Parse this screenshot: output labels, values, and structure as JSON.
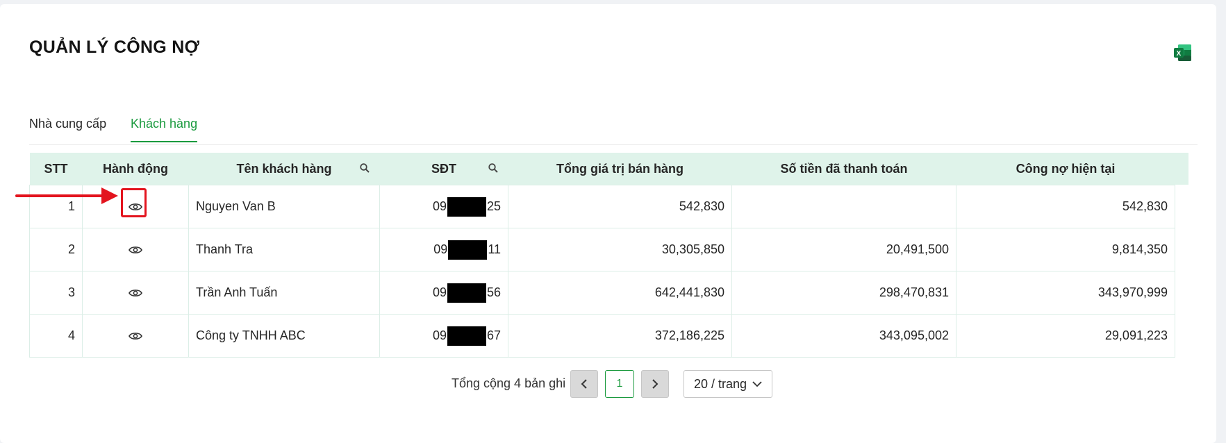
{
  "page": {
    "title": "QUẢN LÝ CÔNG NỢ",
    "export_icon": "excel-icon"
  },
  "tabs": [
    {
      "label": "Nhà cung cấp",
      "active": false
    },
    {
      "label": "Khách hàng",
      "active": true
    }
  ],
  "table": {
    "columns": [
      "STT",
      "Hành động",
      "Tên khách hàng",
      "SĐT",
      "Tổng giá trị bán hàng",
      "Số tiền đã thanh toán",
      "Công nợ hiện tại"
    ],
    "rows": [
      {
        "stt": "1",
        "name": "Nguyen Van B",
        "phone_prefix": "09",
        "phone_suffix": "25",
        "total": "542,830",
        "paid": "",
        "debt": "542,830"
      },
      {
        "stt": "2",
        "name": "Thanh Tra",
        "phone_prefix": "09",
        "phone_suffix": "11",
        "total": "30,305,850",
        "paid": "20,491,500",
        "debt": "9,814,350"
      },
      {
        "stt": "3",
        "name": "Trần Anh Tuấn",
        "phone_prefix": "09",
        "phone_suffix": "56",
        "total": "642,441,830",
        "paid": "298,470,831",
        "debt": "343,970,999"
      },
      {
        "stt": "4",
        "name": "Công ty TNHH ABC",
        "phone_prefix": "09",
        "phone_suffix": "67",
        "total": "372,186,225",
        "paid": "343,095,002",
        "debt": "29,091,223"
      }
    ]
  },
  "pagination": {
    "total_label": "Tổng cộng 4 bản ghi",
    "current_page": "1",
    "page_size": "20 / trang"
  },
  "colors": {
    "accent": "#1a9a3e",
    "header_bg": "#dff3ea",
    "annotation": "#e3141e"
  }
}
